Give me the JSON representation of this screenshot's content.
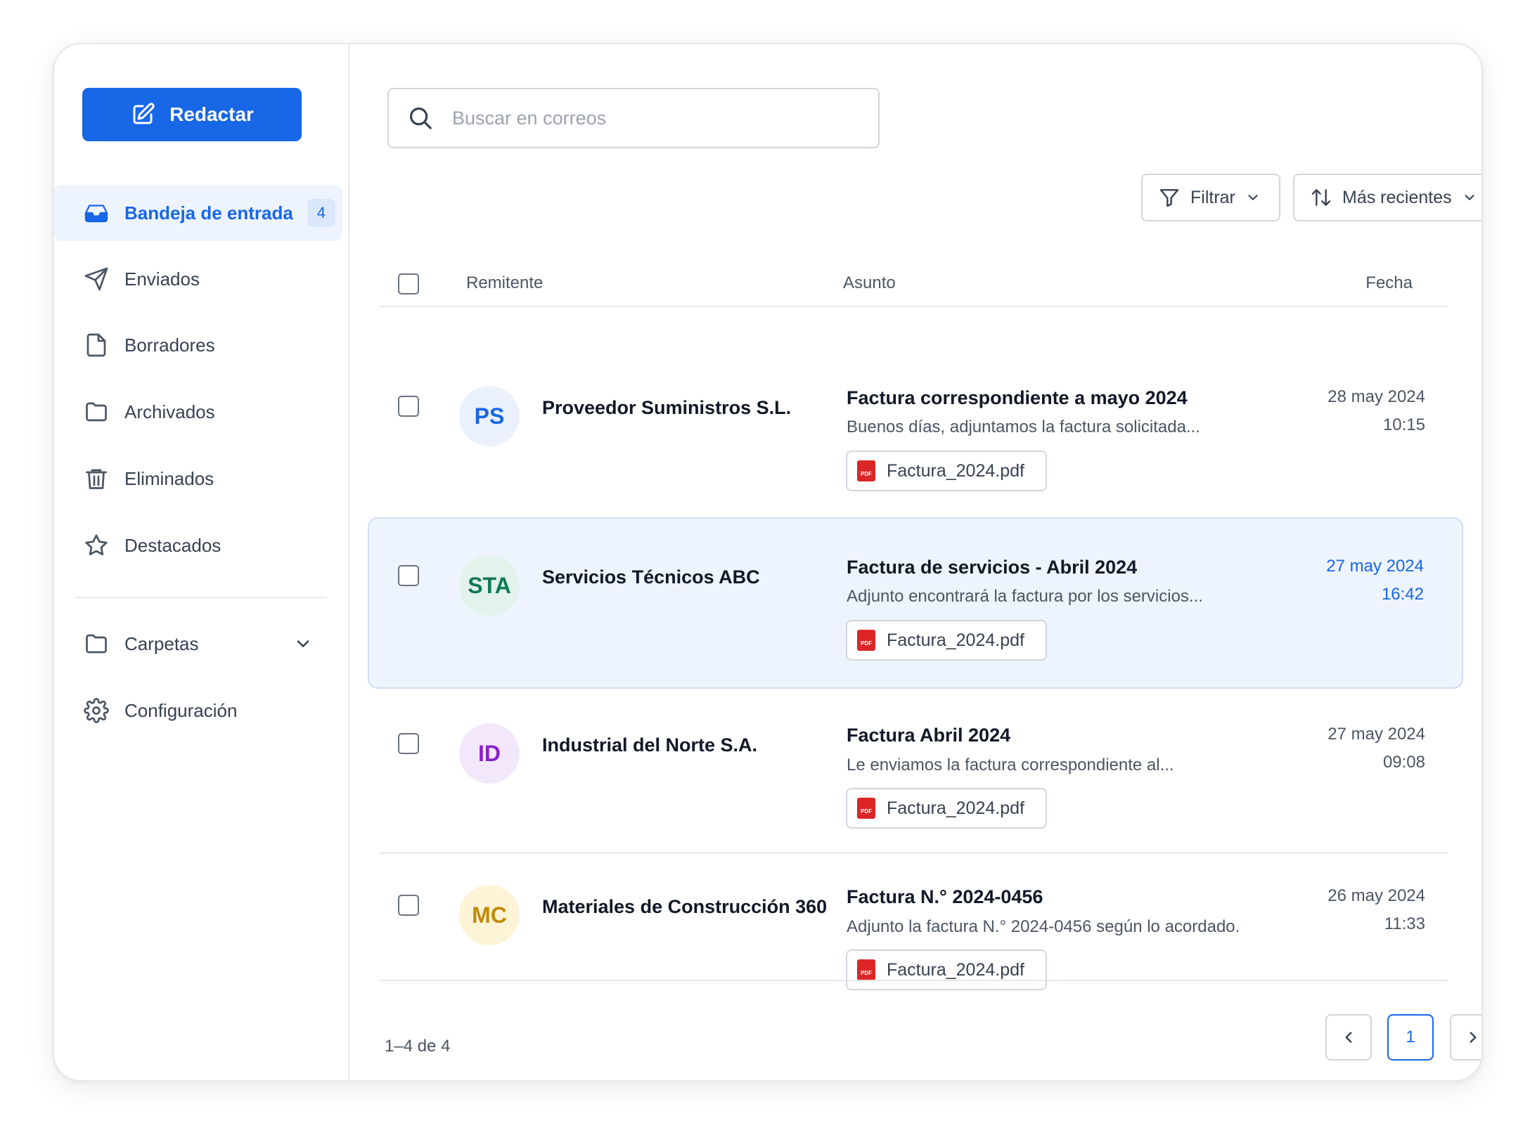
{
  "compose": {
    "label": "Redactar"
  },
  "sidebar": {
    "items": [
      {
        "label": "Bandeja de entrada",
        "icon": "inbox-icon",
        "badge": "4",
        "active": true
      },
      {
        "label": "Enviados",
        "icon": "send-icon"
      },
      {
        "label": "Borradores",
        "icon": "file-icon"
      },
      {
        "label": "Archivados",
        "icon": "folder-icon"
      },
      {
        "label": "Eliminados",
        "icon": "trash-icon"
      },
      {
        "label": "Destacados",
        "icon": "star-icon"
      }
    ],
    "folders_label": "Carpetas",
    "settings_label": "Configuración"
  },
  "search": {
    "placeholder": "Buscar en correos",
    "value": ""
  },
  "toolbar": {
    "filter_label": "Filtrar",
    "sort_label": "Más recientes"
  },
  "table": {
    "headers": {
      "sender": "Remitente",
      "subject": "Asunto",
      "date": "Fecha"
    },
    "rows": [
      {
        "initials": "PS",
        "avatar_bg": "#eaf1fc",
        "avatar_fg": "#1767e6",
        "sender": "Proveedor Suministros S.L.",
        "subject": "Factura correspondiente a mayo 2024",
        "preview": "Buenos días, adjuntamos la factura solicitada...",
        "attachment": "Factura_2024.pdf",
        "date": "28 may 2024",
        "time": "10:15",
        "selected": false
      },
      {
        "initials": "STA",
        "avatar_bg": "#e3f3ec",
        "avatar_fg": "#0f7a55",
        "sender": "Servicios Técnicos ABC",
        "subject": "Factura de servicios - Abril 2024",
        "preview": "Adjunto encontrará la factura por los servicios...",
        "attachment": "Factura_2024.pdf",
        "date": "27 may 2024",
        "time": "16:42",
        "selected": true
      },
      {
        "initials": "ID",
        "avatar_bg": "#f3e8fb",
        "avatar_fg": "#8b22c9",
        "sender": "Industrial del Norte S.A.",
        "subject": "Factura Abril 2024",
        "preview": "Le enviamos la factura correspondiente al...",
        "attachment": "Factura_2024.pdf",
        "date": "27 may 2024",
        "time": "09:08",
        "selected": false
      },
      {
        "initials": "MC",
        "avatar_bg": "#fdf3d6",
        "avatar_fg": "#c28a09",
        "sender": "Materiales de Construcción 360",
        "subject": "Factura N.° 2024-0456",
        "preview": "Adjunto la factura N.° 2024-0456 según lo acordado.",
        "attachment": "Factura_2024.pdf",
        "date": "26 may 2024",
        "time": "11:33",
        "selected": false
      }
    ]
  },
  "pagination": {
    "summary": "1–4 de 4",
    "current_page": "1"
  },
  "colors": {
    "accent": "#1767e6",
    "selected_row_bg": "#eef4fd",
    "pdf_red": "#dc2626"
  }
}
